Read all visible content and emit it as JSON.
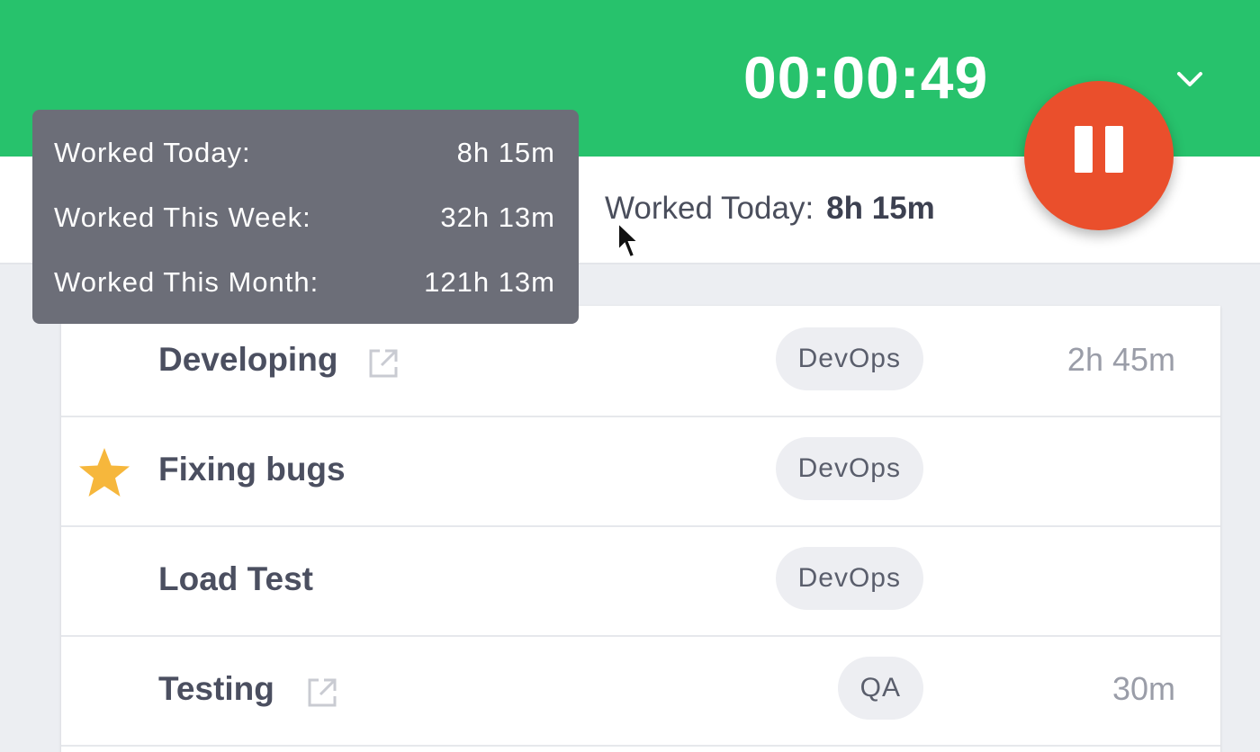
{
  "header": {
    "timer": "00:00:49",
    "accent_color": "#27c26c",
    "chevron_icon": "chevron-down-icon",
    "pause_button_color": "#ea4f2c",
    "pause_icon": "pause-icon"
  },
  "summary": {
    "worked_today_label": "Worked Today:",
    "worked_today_value": "8h 15m"
  },
  "tooltip": {
    "rows": [
      {
        "label": "Worked Today:",
        "value": "8h 15m"
      },
      {
        "label": "Worked This Week:",
        "value": "32h 13m"
      },
      {
        "label": "Worked This Month:",
        "value": "121h 13m"
      }
    ]
  },
  "tasks": [
    {
      "name": "Developing",
      "tag": "DevOps",
      "duration": "2h 45m",
      "external_link": true,
      "starred": false
    },
    {
      "name": "Fixing bugs",
      "tag": "DevOps",
      "duration": "",
      "external_link": false,
      "starred": true
    },
    {
      "name": "Load Test",
      "tag": "DevOps",
      "duration": "",
      "external_link": false,
      "starred": false
    },
    {
      "name": "Testing",
      "tag": "QA",
      "duration": "30m",
      "external_link": true,
      "starred": false
    }
  ],
  "icons": {
    "star": "star-icon",
    "external_link": "external-link-icon",
    "cursor": "mouse-cursor-icon"
  },
  "colors": {
    "star": "#f6b73c",
    "tooltip_bg": "#6c6e78"
  }
}
